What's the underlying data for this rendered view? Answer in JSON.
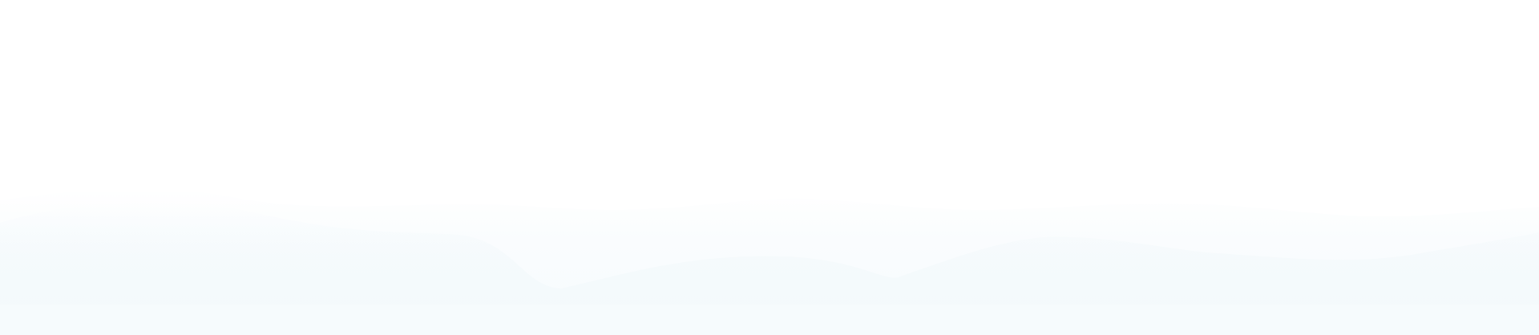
{
  "background": {
    "base_color": "#ffffff",
    "wave_color": "#f5fafd",
    "wave_color_soft": "#f8fcfd"
  }
}
